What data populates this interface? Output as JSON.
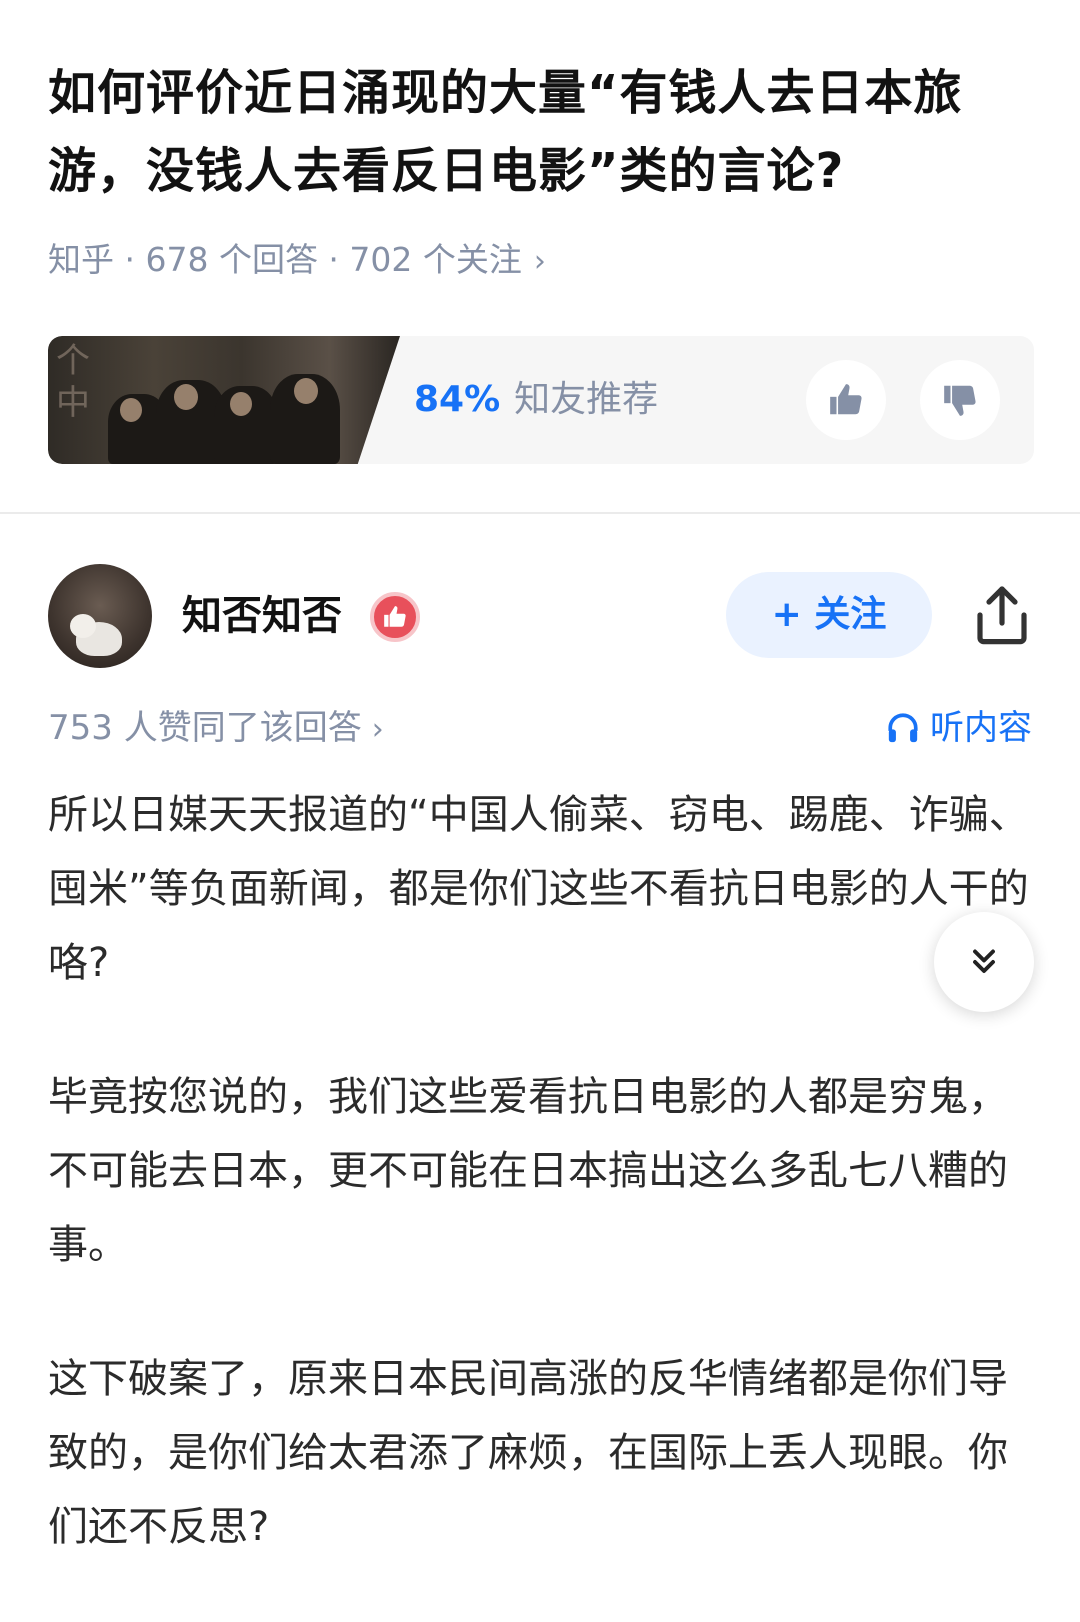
{
  "question": {
    "title": "如何评价近日涌现的大量“有钱人去日本旅游，没钱人去看反日电影”类的言论?",
    "meta": "知乎 · 678 个回答 · 702 个关注",
    "meta_chevron": "›"
  },
  "recommendation": {
    "thumb_glyphs": "个\n中",
    "percent": "84%",
    "label": "知友推荐"
  },
  "answer": {
    "author_name": "知否知否",
    "follow_label": "+ 关注",
    "votes_text": "753 人赞同了该回答",
    "votes_chevron": "›",
    "listen_label": "听内容",
    "paragraphs": [
      "所以日媒天天报道的“中国人偷菜、窃电、踢鹿、诈骗、囤米”等负面新闻，都是你们这些不看抗日电影的人干的咯?",
      "毕竟按您说的，我们这些爱看抗日电影的人都是穷鬼，不可能去日本，更不可能在日本搞出这么多乱七八糟的事。",
      "这下破案了，原来日本民间高涨的反华情绪都是你们导致的，是你们给太君添了麻烦，在国际上丢人现眼。你们还不反思?"
    ]
  },
  "icons": {
    "thumb_up": "thumbs-up-icon",
    "thumb_down": "thumbs-down-icon",
    "badge": "thumbs-up-badge-icon",
    "share": "share-icon",
    "headphones": "headphones-icon",
    "expand": "double-chevron-down-icon"
  },
  "colors": {
    "accent": "#1772f6",
    "meta_gray": "#8590a6",
    "badge_red": "#e8505b",
    "follow_bg": "#eaf2ff"
  }
}
